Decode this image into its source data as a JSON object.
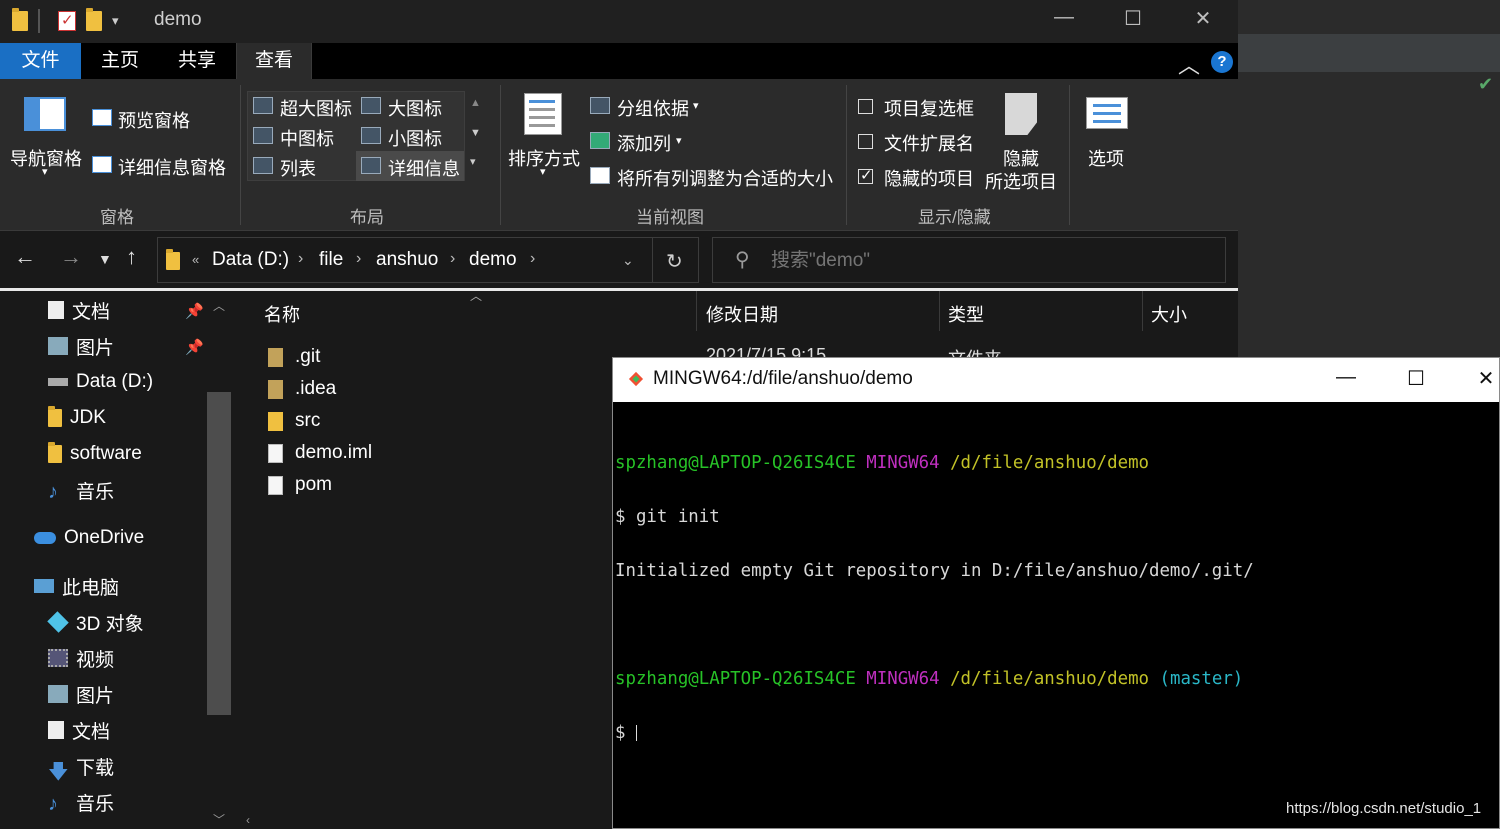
{
  "explorer": {
    "window_title": "demo",
    "tabs": {
      "file": "文件",
      "home": "主页",
      "share": "共享",
      "view": "查看"
    },
    "ribbon": {
      "pane": {
        "nav_pane": "导航窗格",
        "preview_pane": "预览窗格",
        "details_pane": "详细信息窗格",
        "group": "窗格"
      },
      "layout": {
        "extra_large": "超大图标",
        "large": "大图标",
        "medium": "中图标",
        "small": "小图标",
        "list": "列表",
        "details": "详细信息",
        "group": "布局"
      },
      "current_view": {
        "sort_by": "排序方式",
        "group_by": "分组依据",
        "add_columns": "添加列",
        "size_all_columns": "将所有列调整为合适的大小",
        "group": "当前视图"
      },
      "show_hide": {
        "item_checkboxes": "项目复选框",
        "file_extensions": "文件扩展名",
        "hidden_items": "隐藏的项目",
        "hide_selected_1": "隐藏",
        "hide_selected_2": "所选项目",
        "group": "显示/隐藏",
        "item_checkboxes_checked": false,
        "file_extensions_checked": false,
        "hidden_items_checked": true
      },
      "options": "选项"
    },
    "address": {
      "crumbs": [
        "Data (D:)",
        "file",
        "anshuo",
        "demo"
      ]
    },
    "search": {
      "placeholder": "搜索\"demo\""
    },
    "sidebar": [
      {
        "label": "文档",
        "icon": "document-icon",
        "pinned": true
      },
      {
        "label": "图片",
        "icon": "picture-icon",
        "pinned": true
      },
      {
        "label": "Data (D:)",
        "icon": "drive-icon",
        "pinned": false
      },
      {
        "label": "JDK",
        "icon": "folder-icon",
        "pinned": false
      },
      {
        "label": "software",
        "icon": "folder-icon",
        "pinned": false
      },
      {
        "label": "音乐",
        "icon": "music-icon",
        "pinned": false
      },
      {
        "label": "OneDrive",
        "icon": "cloud-icon",
        "pinned": false
      },
      {
        "label": "此电脑",
        "icon": "computer-icon",
        "pinned": false
      },
      {
        "label": "3D 对象",
        "icon": "cube-icon",
        "pinned": false
      },
      {
        "label": "视频",
        "icon": "video-icon",
        "pinned": false
      },
      {
        "label": "图片",
        "icon": "picture-icon",
        "pinned": false
      },
      {
        "label": "文档",
        "icon": "document-icon",
        "pinned": false
      },
      {
        "label": "下载",
        "icon": "download-icon",
        "pinned": false
      },
      {
        "label": "音乐",
        "icon": "music-icon",
        "pinned": false
      }
    ],
    "columns": {
      "name": "名称",
      "modified": "修改日期",
      "type": "类型",
      "size": "大小"
    },
    "files": [
      {
        "name": ".git",
        "kind": "folder",
        "modified": "2021/7/15 9:15",
        "type": "文件夹"
      },
      {
        "name": ".idea",
        "kind": "folder"
      },
      {
        "name": "src",
        "kind": "folder"
      },
      {
        "name": "demo.iml",
        "kind": "file"
      },
      {
        "name": "pom",
        "kind": "file"
      }
    ]
  },
  "bash": {
    "title": "MINGW64:/d/file/anshuo/demo",
    "lines": [
      {
        "user": "spzhang@LAPTOP-Q26IS4CE",
        "env": "MINGW64",
        "path": "/d/file/anshuo/demo",
        "branch": ""
      },
      {
        "text": "$ git init"
      },
      {
        "text": "Initialized empty Git repository in D:/file/anshuo/demo/.git/"
      },
      {
        "text": ""
      },
      {
        "user": "spzhang@LAPTOP-Q26IS4CE",
        "env": "MINGW64",
        "path": "/d/file/anshuo/demo",
        "branch": "(master)"
      },
      {
        "text": "$ "
      }
    ]
  },
  "watermark": "https://blog.csdn.net/studio_1",
  "colors": {
    "accent": "#1a6fc4",
    "term_green": "#27c227",
    "term_magenta": "#bf2fbf",
    "term_yellow": "#c2c227",
    "term_cyan": "#2ab7c7"
  }
}
